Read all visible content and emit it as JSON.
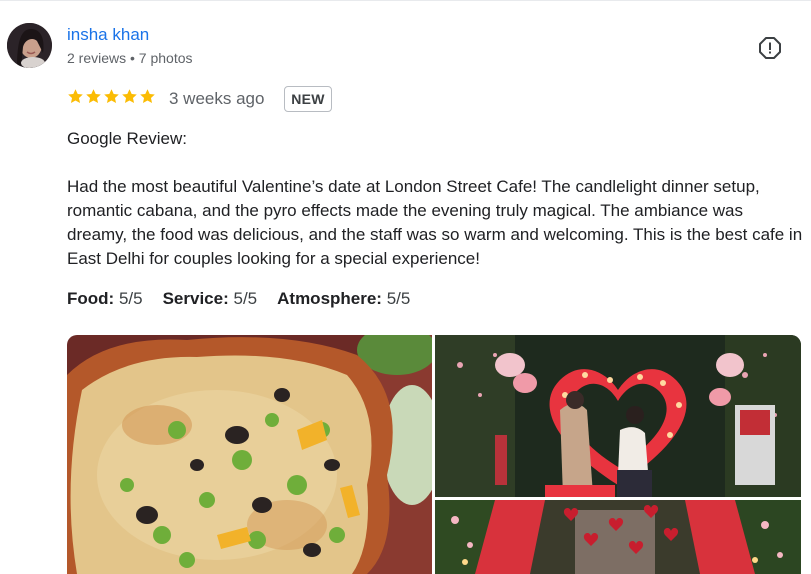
{
  "reviewer": {
    "name": "insha khan",
    "meta": "2 reviews • 7 photos"
  },
  "review": {
    "rating": 5,
    "time": "3 weeks ago",
    "badge": "NEW",
    "text": "Google Review:\n\nHad the most beautiful Valentine’s date at London Street Cafe! The candlelight dinner setup, romantic cabana, and the pyro effects made the evening truly magical. The ambiance was dreamy, the food was delicious, and the staff was so warm and welcoming. This is the best cafe in East Delhi for couples looking for a special experience!"
  },
  "ratings": [
    {
      "label": "Food:",
      "value": "5/5"
    },
    {
      "label": "Service:",
      "value": "5/5"
    },
    {
      "label": "Atmosphere:",
      "value": "5/5"
    }
  ],
  "icons": {
    "report": "report-flag-icon",
    "star": "star-icon"
  },
  "colors": {
    "link": "#1a73e8",
    "star": "#fbbc04",
    "meta": "#5f6368"
  }
}
